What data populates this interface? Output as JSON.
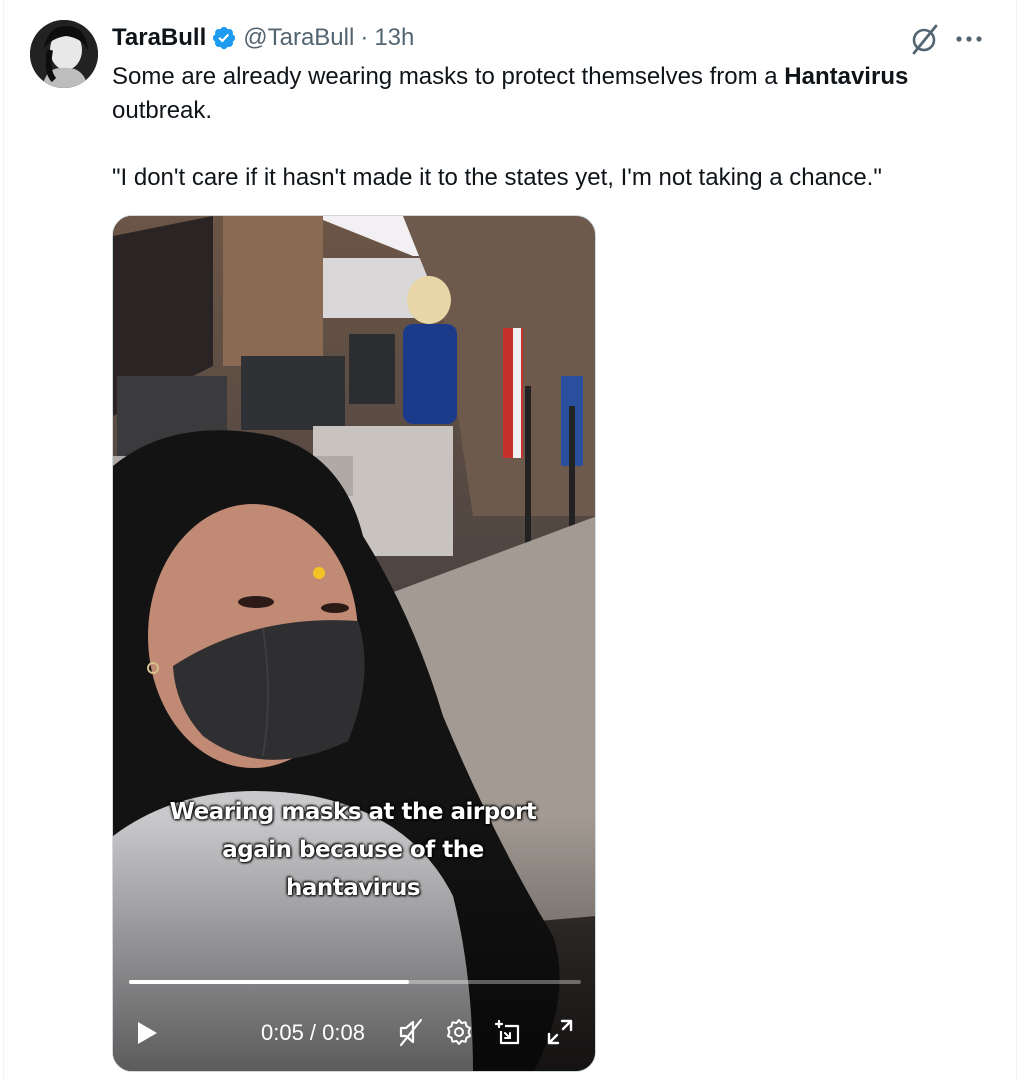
{
  "colors": {
    "verified": "#1d9bf0",
    "text_primary": "#0f1419",
    "text_secondary": "#536471"
  },
  "author": {
    "name": "TaraBull",
    "handle": "@TaraBull",
    "separator": "·",
    "time": "13h",
    "avatar_icon": "avatar-photo",
    "verified_icon": "verified-badge-icon"
  },
  "actions": {
    "grok_icon": "grok-icon",
    "more_icon": "more-icon"
  },
  "tweet": {
    "text_before": "Some are already wearing masks to protect themselves from a ",
    "text_bold": "Hantavirus",
    "text_after": " outbreak.",
    "quote": "\"I don't care if it hasn't made it to the states yet, I'm not taking a chance.\""
  },
  "video": {
    "caption": "Wearing masks at the airport\nagain because of the\nhantavirus",
    "progress": 0.62,
    "time_readout": "0:05 / 0:08",
    "controls": [
      "play-icon",
      "mute-icon",
      "settings-icon",
      "pip-icon",
      "fullscreen-icon"
    ]
  }
}
